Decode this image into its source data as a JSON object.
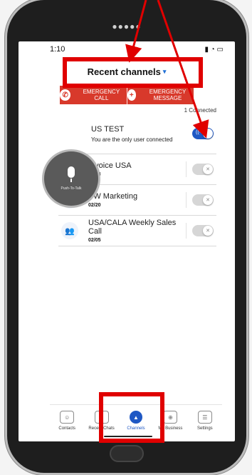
{
  "status": {
    "time": "1:10",
    "icons": "signal wifi battery"
  },
  "header": {
    "title": "Recent channels",
    "caret": "▾"
  },
  "emergency": {
    "call_label": "EMERGENCY CALL",
    "message_label": "EMERGENCY MESSAGE"
  },
  "connected_count": "1 Connected",
  "push_to_talk": {
    "label": "Push-To-Talk"
  },
  "channels": [
    {
      "name": "US TEST",
      "subtitle": "You are the only user connected",
      "active": true
    },
    {
      "name": "Invoice USA",
      "date": "02/08",
      "active": false
    },
    {
      "name": "SW Marketing",
      "date": "02/20",
      "active": false
    },
    {
      "name": "USA/CALA Weekly Sales Call",
      "date": "02/05",
      "active": false
    }
  ],
  "tabs": [
    {
      "label": "Contacts",
      "icon": "contacts-icon"
    },
    {
      "label": "Recent Chats",
      "icon": "chat-icon"
    },
    {
      "label": "Channels",
      "icon": "channels-icon",
      "active": true
    },
    {
      "label": "My Business",
      "icon": "business-icon"
    },
    {
      "label": "Settings",
      "icon": "settings-icon"
    }
  ],
  "colors": {
    "accent": "#1f58c4",
    "emergency": "#d8392b",
    "annotation": "#e00000"
  }
}
